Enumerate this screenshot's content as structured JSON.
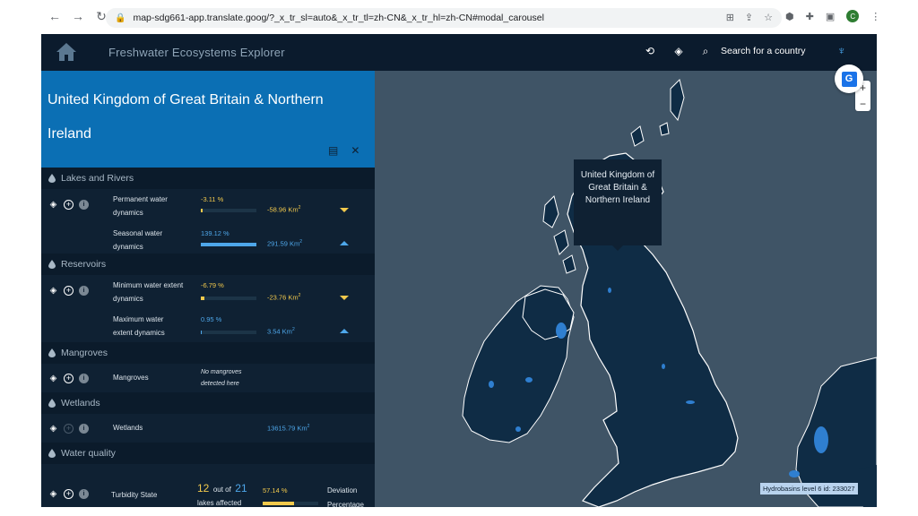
{
  "browser": {
    "url": "map-sdg661-app.translate.goog/?_x_tr_sl=auto&_x_tr_tl=zh-CN&_x_tr_hl=zh-CN#modal_carousel",
    "avatar_letter": "C"
  },
  "app": {
    "title": "Freshwater Ecosystems Explorer",
    "search_label": "Search for a country",
    "country_title": "United Kingdom of Great Britain & Northern Ireland",
    "tooltip": "United Kingdom of Great Britain & Northern Ireland",
    "hydro_label": "Hydrobasins level 6 id: 233027",
    "zoom_in": "+",
    "zoom_out": "−"
  },
  "sections": {
    "lakes": "Lakes and Rivers",
    "reservoirs": "Reservoirs",
    "mangroves": "Mangroves",
    "wetlands": "Wetlands",
    "water_quality": "Water quality"
  },
  "metrics": {
    "permanent": {
      "label": "Permanent water dynamics",
      "pct": "-3.11 %",
      "km": "-58.96 Km",
      "level": 0.03
    },
    "seasonal": {
      "label": "Seasonal water dynamics",
      "pct": "139.12 %",
      "km": "291.59 Km",
      "level": 1.0
    },
    "minimum": {
      "label": "Minimum water extent dynamics",
      "pct": "-6.79 %",
      "km": "-23.76 Km",
      "level": 0.07
    },
    "maximum": {
      "label": "Maximum water extent dynamics",
      "pct": "0.95 %",
      "km": "3.54 Km",
      "level": 0.01
    },
    "mangroves": {
      "label": "Mangroves",
      "note": "No mangroves detected here"
    },
    "wetlands": {
      "label": "Wetlands",
      "km": "13615.79 Km"
    },
    "turbidity": {
      "label": "Turbidity State",
      "affected": "12",
      "out_of": "out of",
      "total": "21",
      "lakes_affected": "lakes affected",
      "pct": "57.14 %",
      "level": 0.5714,
      "deviation": "Deviation Percentage"
    }
  },
  "unit_sup": "2",
  "colors": {
    "accent_blue": "#0b6fb4",
    "negative": "#f2c94c",
    "positive": "#4ea7ea"
  }
}
